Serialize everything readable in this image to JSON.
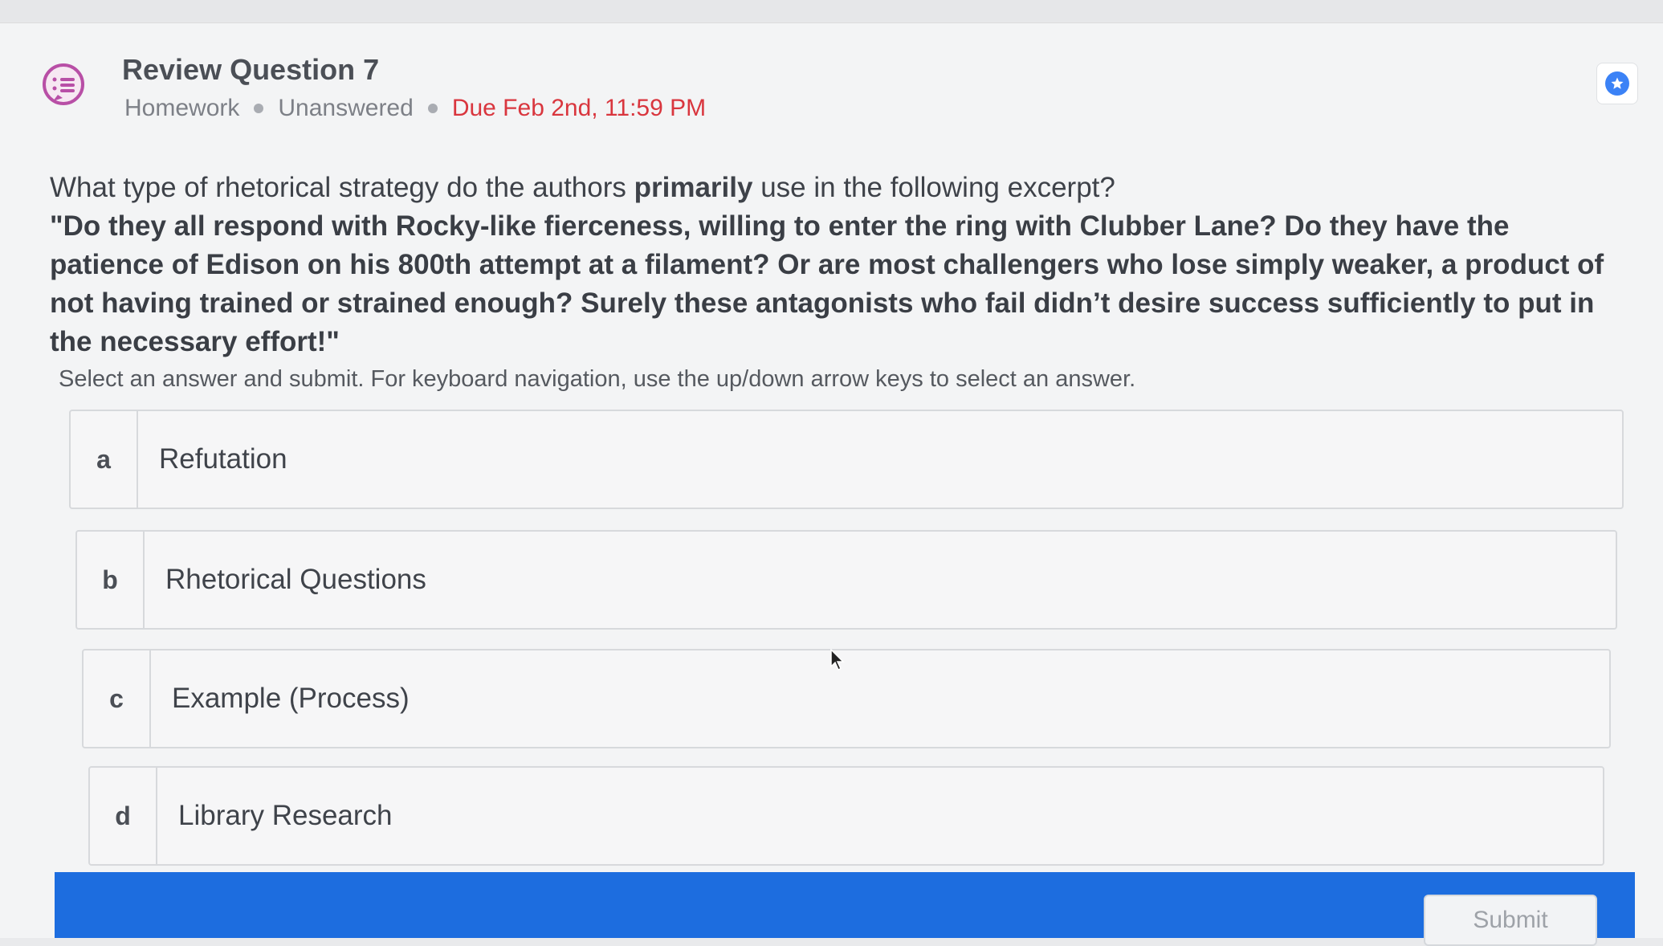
{
  "header": {
    "title": "Review Question 7",
    "type": "Homework",
    "status": "Unanswered",
    "due": "Due Feb 2nd, 11:59 PM",
    "icon": "list-chat-icon",
    "bookmark_icon": "star-icon"
  },
  "question": {
    "prompt_before": "What type of rhetorical strategy do the authors ",
    "prompt_emphasis": "primarily",
    "prompt_after": " use in the following excerpt?",
    "excerpt": "\"Do they all respond with Rocky-like fierceness, willing to enter the ring with Clubber Lane? Do they have the patience of Edison on his 800th attempt at a filament? Or are most challengers who lose simply weaker, a product of not having trained or strained enough? Surely these antagonists who fail didn’t desire success sufficiently to put in the necessary effort!\""
  },
  "instructions": "Select an answer and submit. For keyboard navigation, use the up/down arrow keys to select an answer.",
  "options": [
    {
      "letter": "a",
      "label": "Refutation"
    },
    {
      "letter": "b",
      "label": "Rhetorical Questions"
    },
    {
      "letter": "c",
      "label": "Example (Process)"
    },
    {
      "letter": "d",
      "label": "Library Research"
    }
  ],
  "submit": {
    "label": "Submit"
  },
  "colors": {
    "accent": "#1d6ddf",
    "due": "#d9363e",
    "icon": "#b84fa6",
    "star": "#3b82f6"
  }
}
